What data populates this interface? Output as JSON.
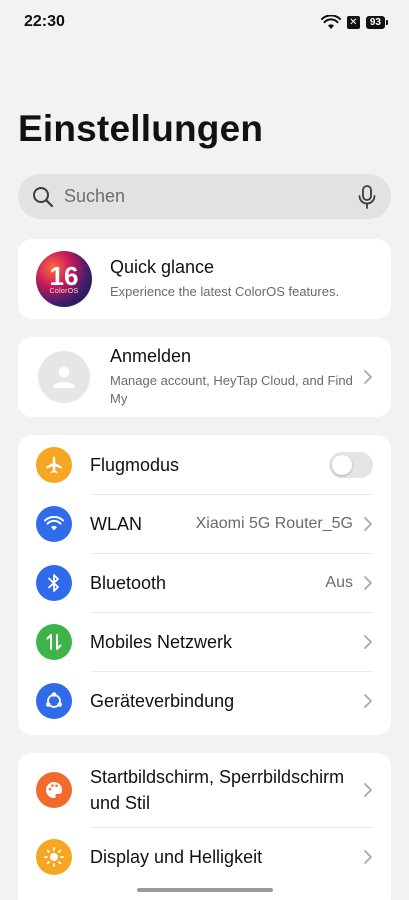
{
  "status_bar": {
    "time": "22:30",
    "battery": "93",
    "notif_badge": "✕",
    "icons": [
      "wifi-icon",
      "notification-badge-icon",
      "battery-icon"
    ]
  },
  "header": {
    "title": "Einstellungen"
  },
  "search": {
    "placeholder": "Suchen",
    "icons": [
      "search-icon",
      "mic-icon"
    ]
  },
  "quick_glance": {
    "logo_number": "16",
    "logo_text": "ColorOS",
    "title": "Quick glance",
    "subtitle": "Experience the latest ColorOS features."
  },
  "account": {
    "title": "Anmelden",
    "subtitle": "Manage account, HeyTap Cloud, and Find My"
  },
  "connectivity": [
    {
      "label": "Flugmodus",
      "value": "",
      "icon": "airplane-icon",
      "color": "#f5a623",
      "control": "toggle",
      "toggle_on": false
    },
    {
      "label": "WLAN",
      "value": "Xiaomi 5G Router_5G",
      "icon": "wifi-icon",
      "color": "#2f6bea",
      "control": "chevron"
    },
    {
      "label": "Bluetooth",
      "value": "Aus",
      "icon": "bluetooth-icon",
      "color": "#2f6bea",
      "control": "chevron"
    },
    {
      "label": "Mobiles Netzwerk",
      "value": "",
      "icon": "mobile-data-icon",
      "color": "#3fb24a",
      "control": "chevron"
    },
    {
      "label": "Geräteverbindung",
      "value": "",
      "icon": "device-connection-icon",
      "color": "#2f6bea",
      "control": "chevron"
    }
  ],
  "display": [
    {
      "label": "Startbildschirm, Sperrbildschirm und Stil",
      "icon": "palette-icon",
      "color": "#f26b2e"
    },
    {
      "label": "Display und Helligkeit",
      "icon": "sun-icon",
      "color": "#f5a623"
    }
  ],
  "colors": {
    "background": "#f2f2f3",
    "card": "#ffffff",
    "accent_blue": "#2f6bea"
  }
}
